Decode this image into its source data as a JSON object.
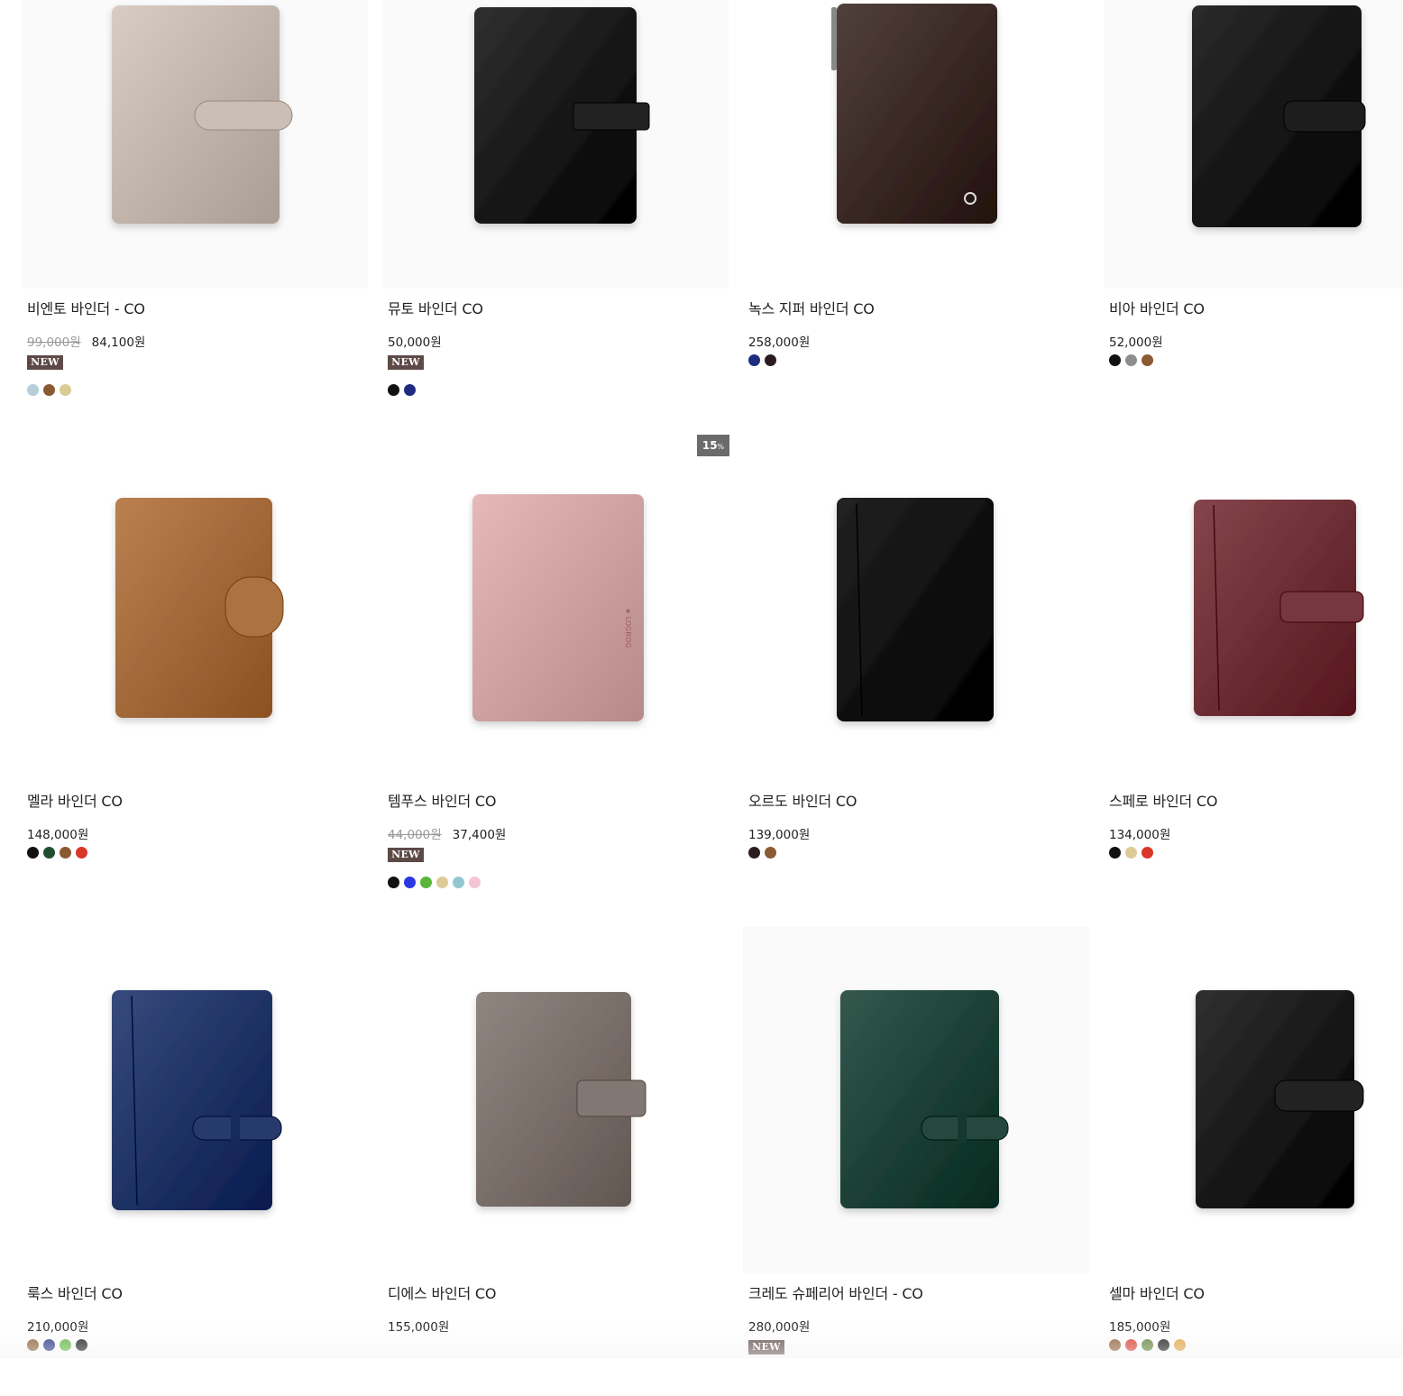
{
  "sale_badge": {
    "value": "15",
    "unit": "%"
  },
  "products": [
    {
      "name": "비엔토 바인더 - CO",
      "original_price": "99,000원",
      "price": "84,100원",
      "badge": "NEW",
      "colors": [
        "#b7cdd9",
        "#8a5a32",
        "#dccb95"
      ]
    },
    {
      "name": "뮤토 바인더 CO",
      "original_price": "",
      "price": "50,000원",
      "badge": "NEW",
      "colors": [
        "#111111",
        "#1e2c80"
      ]
    },
    {
      "name": "녹스 지퍼 바인더 CO",
      "original_price": "",
      "price": "258,000원",
      "badge": "",
      "colors": [
        "#1e2c80",
        "#2b1d1f"
      ]
    },
    {
      "name": "비아 바인더 CO",
      "original_price": "",
      "price": "52,000원",
      "badge": "",
      "colors": [
        "#111111",
        "#8e8e8e",
        "#8a5a32"
      ]
    },
    {
      "name": "멜라 바인더 CO",
      "original_price": "",
      "price": "148,000원",
      "badge": "",
      "colors": [
        "#111111",
        "#1f4d30",
        "#8a5a32",
        "#d9372a"
      ]
    },
    {
      "name": "템푸스 바인더 CO",
      "original_price": "44,000원",
      "price": "37,400원",
      "badge": "NEW",
      "colors": [
        "#111111",
        "#2b37e0",
        "#5ab53a",
        "#dccb95",
        "#93c7cf",
        "#f3c5d6"
      ]
    },
    {
      "name": "오르도 바인더 CO",
      "original_price": "",
      "price": "139,000원",
      "badge": "",
      "colors": [
        "#2b1d1f",
        "#8a5a32"
      ]
    },
    {
      "name": "스페로 바인더 CO",
      "original_price": "",
      "price": "134,000원",
      "badge": "",
      "colors": [
        "#111111",
        "#dccb95",
        "#d9372a"
      ]
    },
    {
      "name": "룩스 바인더 CO",
      "original_price": "",
      "price": "210,000원",
      "badge": "",
      "colors": [
        "#8a5a32",
        "#1e2c80",
        "#5ab53a",
        "#111111"
      ]
    },
    {
      "name": "디에스 바인더 CO",
      "original_price": "",
      "price": "155,000원",
      "badge": "",
      "colors": []
    },
    {
      "name": "크레도 슈페리어 바인더 - CO",
      "original_price": "",
      "price": "280,000원",
      "badge": "NEW",
      "colors": []
    },
    {
      "name": "셀마 바인더 CO",
      "original_price": "",
      "price": "185,000원",
      "badge": "",
      "colors": [
        "#8a5a32",
        "#d9372a",
        "#5a7f34",
        "#111111",
        "#e0a43a"
      ]
    }
  ],
  "binder_colors": [
    "#c3b6ac",
    "#1a1a1a",
    "#3b2a26",
    "#151515",
    "#a46a3a",
    "#cfa3a2",
    "#0c0c0c",
    "#6e2f36",
    "#213466",
    "#7a706b",
    "#1e4238",
    "#1a1a1a"
  ],
  "icons": [
    "leather-binder-image",
    "color-swatch"
  ]
}
